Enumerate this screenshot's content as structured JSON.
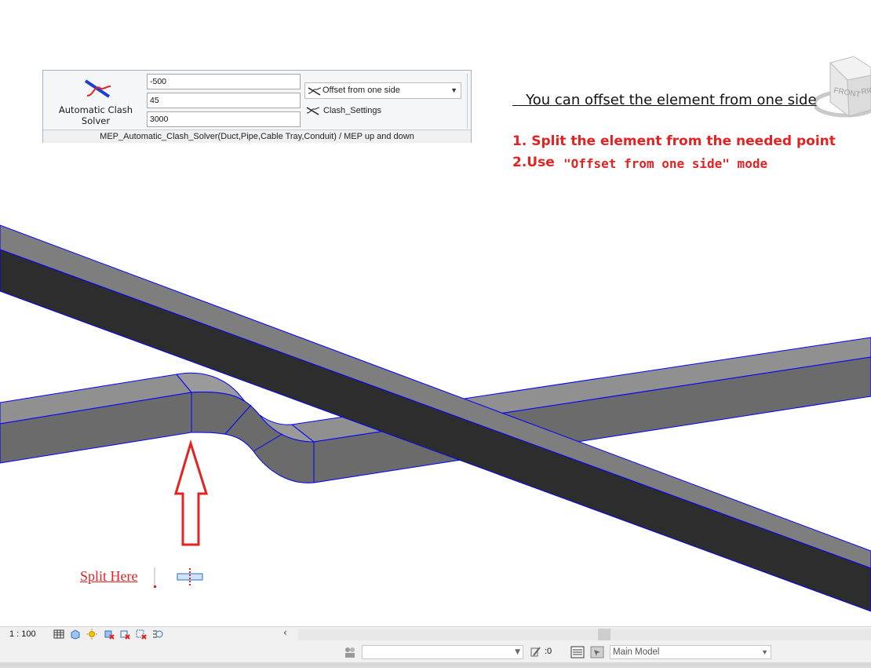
{
  "ribbon": {
    "tool_label": "Automatic Clash Solver",
    "inputs": [
      "-500",
      "45",
      "3000"
    ],
    "mode_dropdown": "Offset from one side",
    "settings_button": "Clash_Settings",
    "panel_title": "MEP_Automatic_Clash_Solver(Duct,Pipe,Cable Tray,Conduit) / MEP up and down"
  },
  "viewcube": {
    "face_front": "FRONT",
    "face_right": "RIG"
  },
  "annotations": {
    "headline": "   You can offset the element from one side",
    "step1": "1. Split the element from the needed point",
    "step2_prefix": "2.Use",
    "step2_mode": "\"Offset from one side\" mode",
    "split_label": "Split Here"
  },
  "status": {
    "scale": "1 : 100",
    "editable_count": ":0",
    "active_model": "Main Model"
  },
  "colors": {
    "annotation_red": "#e32322",
    "duct_top": "#808080",
    "duct_side": "#2d2d2d",
    "duct_edge": "#0000ff"
  }
}
